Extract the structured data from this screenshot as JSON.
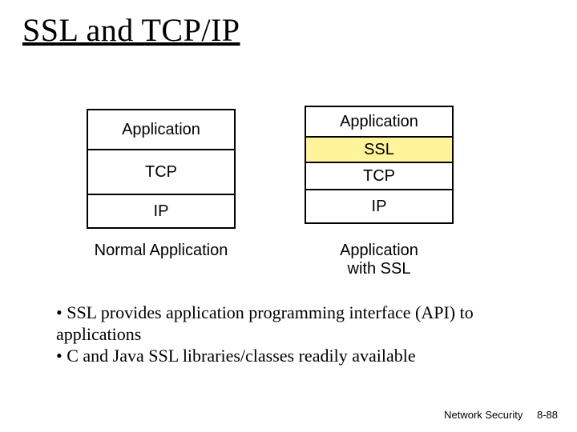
{
  "title": "SSL and TCP/IP",
  "left_stack": {
    "layers": {
      "application": "Application",
      "tcp": "TCP",
      "ip": "IP"
    },
    "caption": "Normal Application"
  },
  "right_stack": {
    "layers": {
      "application": "Application",
      "ssl": "SSL",
      "tcp": "TCP",
      "ip": "IP"
    },
    "caption_line1": "Application",
    "caption_line2": "with SSL"
  },
  "bullets": {
    "b1": "• SSL provides application programming interface (API) to applications",
    "b2": "• C and Java SSL libraries/classes readily available"
  },
  "footer": {
    "label": "Network Security",
    "page": "8-88"
  }
}
